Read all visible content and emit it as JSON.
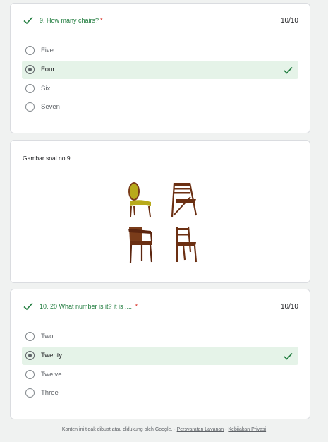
{
  "question9": {
    "title": "9. How many chairs?",
    "required_mark": "*",
    "score": "10/10",
    "options": [
      "Five",
      "Four",
      "Six",
      "Seven"
    ],
    "selected_index": 1,
    "status": "correct"
  },
  "image_block": {
    "caption": "Gambar soal no 9",
    "image_icon": "four-chairs-illustration"
  },
  "question10": {
    "title": "10. 20 What number is it? it is ....",
    "required_mark": "*",
    "score": "10/10",
    "options": [
      "Two",
      "Twenty",
      "Twelve",
      "Three"
    ],
    "selected_index": 1,
    "status": "correct"
  },
  "footer": {
    "text": "Konten ini tidak dibuat atau didukung oleh Google.",
    "sep1": "-",
    "terms_link": "Persyaratan Layanan",
    "sep2": "-",
    "privacy_link": "Kebijakan Privasi"
  },
  "colors": {
    "correct_green": "#1e7b3c",
    "selected_bg": "#e5f3e8",
    "required_red": "#d93025"
  }
}
